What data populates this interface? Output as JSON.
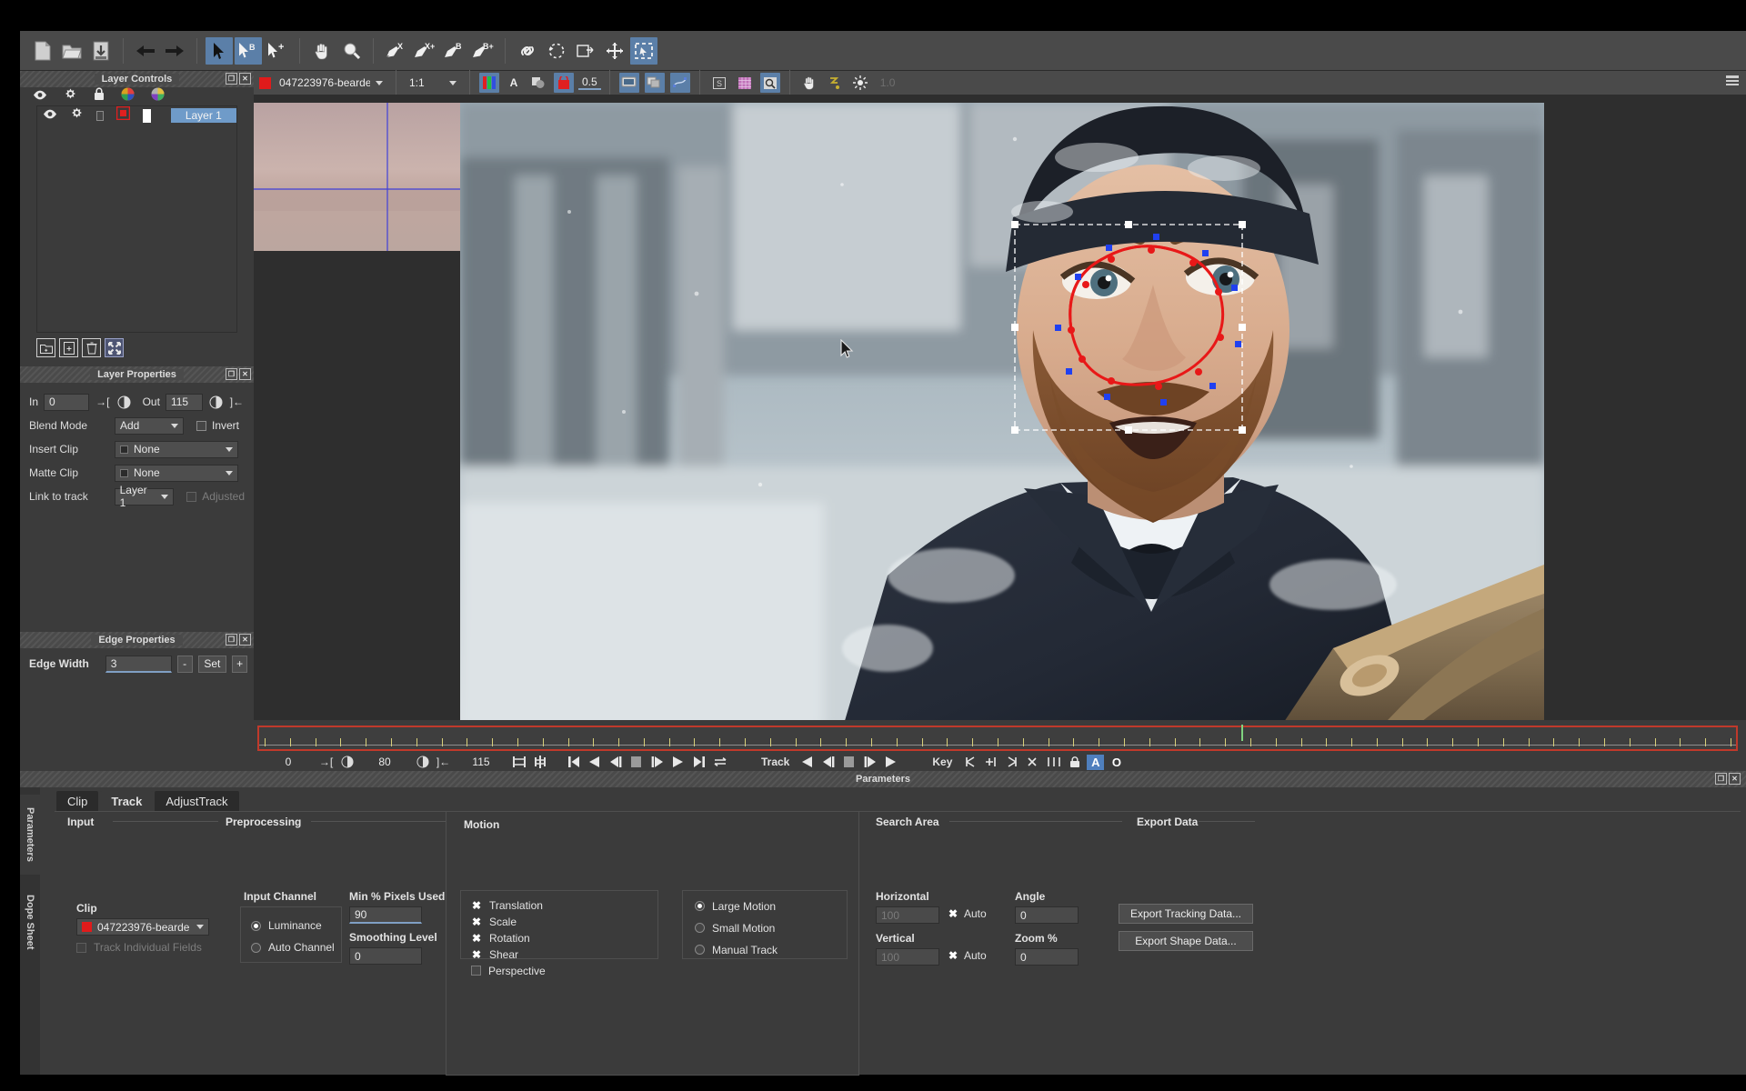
{
  "toolbar": {
    "groups": [
      {
        "name": "file",
        "buttons": [
          {
            "icon": "new-document-icon",
            "label": "New",
            "selected": false
          },
          {
            "icon": "open-folder-icon",
            "label": "Open",
            "selected": false
          },
          {
            "icon": "save-icon",
            "label": "Save",
            "selected": false
          }
        ]
      },
      {
        "name": "history",
        "buttons": [
          {
            "icon": "undo-arrow-icon",
            "label": "Undo",
            "selected": false
          },
          {
            "icon": "redo-arrow-icon",
            "label": "Redo",
            "selected": false
          }
        ]
      },
      {
        "name": "selection",
        "buttons": [
          {
            "icon": "pointer-icon",
            "label": "Select",
            "selected": true
          },
          {
            "icon": "pointer-b-icon",
            "label": "Select B-Spline",
            "selected": true
          },
          {
            "icon": "pointer-plus-icon",
            "label": "Add Point",
            "selected": false
          }
        ]
      },
      {
        "name": "navigation",
        "buttons": [
          {
            "icon": "hand-pan-icon",
            "label": "Pan",
            "selected": false
          },
          {
            "icon": "magnifier-icon",
            "label": "Zoom",
            "selected": false
          }
        ]
      },
      {
        "name": "pens",
        "buttons": [
          {
            "icon": "pen-x-icon",
            "label": "X-Spline",
            "selected": false
          },
          {
            "icon": "pen-x-plus-icon",
            "label": "X-Spline Add",
            "selected": false
          },
          {
            "icon": "pen-b-icon",
            "label": "B-Spline",
            "selected": false
          },
          {
            "icon": "pen-b-plus-icon",
            "label": "B-Spline Add",
            "selected": false
          }
        ]
      },
      {
        "name": "shape-tools",
        "buttons": [
          {
            "icon": "link-chain-icon",
            "label": "Link",
            "selected": false
          },
          {
            "icon": "lasso-icon",
            "label": "Lasso",
            "selected": false
          },
          {
            "icon": "duplicate-shape-icon",
            "label": "Duplicate",
            "selected": false
          },
          {
            "icon": "move-crosshair-icon",
            "label": "Move",
            "selected": false
          },
          {
            "icon": "marquee-select-icon",
            "label": "Marquee Select",
            "selected": true
          }
        ]
      }
    ]
  },
  "clipbar": {
    "clip_color": "#e01b1b",
    "clip_name": "047223976-bearde",
    "zoom_level": "1:1",
    "opacity": "0.5",
    "buttons": [
      {
        "icon": "rgb-channels-icon",
        "label": "RGB Channels",
        "selected": true
      },
      {
        "icon": "alpha-channel-icon",
        "label": "A",
        "selected": false
      },
      {
        "icon": "layers-overlay-icon",
        "label": "Overlay",
        "selected": false
      },
      {
        "icon": "matte-icon",
        "label": "Matte",
        "selected": true
      },
      {
        "icon": "monitor-icon",
        "label": "Monitor View",
        "selected": true
      },
      {
        "icon": "multi-view-icon",
        "label": "Multi View",
        "selected": true
      },
      {
        "icon": "points-view-icon",
        "label": "Point View",
        "selected": true
      },
      {
        "icon": "stabilize-icon",
        "label": "Stabilize",
        "selected": false
      },
      {
        "icon": "grid-icon",
        "label": "Grid",
        "selected": false
      },
      {
        "icon": "magnifier-box-icon",
        "label": "Magnifier",
        "selected": true
      },
      {
        "icon": "hand-small-icon",
        "label": "Hand",
        "selected": false
      },
      {
        "icon": "ruler-icon",
        "label": "Measure",
        "selected": false
      },
      {
        "icon": "brightness-icon",
        "label": "Brightness",
        "selected": false
      }
    ],
    "brightness_value": "1.0"
  },
  "layer_controls": {
    "title": "Layer Controls",
    "header_icons": [
      "eye-icon",
      "gear-icon",
      "lock-icon",
      "color-wheel-icon",
      "color-picker-icon"
    ],
    "rows": [
      {
        "name": "Layer 1",
        "visible": true,
        "settings": true,
        "locked": false,
        "color": "#e01b1b",
        "matte": "#ffffff"
      }
    ],
    "footer_buttons": [
      {
        "icon": "new-folder-icon",
        "label": "New Folder"
      },
      {
        "icon": "new-layer-icon",
        "label": "New Layer"
      },
      {
        "icon": "trash-icon",
        "label": "Delete"
      },
      {
        "icon": "expand-icon",
        "label": "Expand All"
      }
    ]
  },
  "layer_properties": {
    "title": "Layer Properties",
    "in_label": "In",
    "in_value": "0",
    "out_label": "Out",
    "out_value": "115",
    "blend_mode_label": "Blend Mode",
    "blend_mode_value": "Add",
    "invert_label": "Invert",
    "invert_checked": false,
    "insert_clip_label": "Insert Clip",
    "insert_clip_value": "None",
    "matte_clip_label": "Matte Clip",
    "matte_clip_value": "None",
    "link_to_track_label": "Link to track",
    "link_to_track_value": "Layer 1",
    "adjusted_label": "Adjusted",
    "adjusted_checked": false
  },
  "edge_properties": {
    "title": "Edge Properties",
    "edge_width_label": "Edge Width",
    "edge_width_value": "3",
    "minus_label": "-",
    "set_label": "Set",
    "plus_label": "+"
  },
  "timeline": {
    "start_frame": "0",
    "mid_frame": "80",
    "end_frame": "115",
    "current_frame": "115",
    "playhead_pct": 66.5,
    "track_label": "Track",
    "key_label": "Key",
    "transport_icons": [
      "go-to-start-icon",
      "play-backward-icon",
      "step-backward-icon",
      "stop-icon",
      "step-forward-icon",
      "play-forward-icon",
      "go-to-end-icon",
      "loop-icon"
    ],
    "track_icons": [
      "track-backward-icon",
      "track-step-backward-icon",
      "track-stop-icon",
      "track-step-forward-icon",
      "track-forward-icon"
    ],
    "key_icons": [
      "key-prev-icon",
      "key-add-icon",
      "key-next-icon",
      "key-delete-icon",
      "key-all-icon",
      "key-lock-icon"
    ],
    "toggle_a": "A",
    "toggle_o": "O"
  },
  "parameters": {
    "title": "Parameters",
    "vertical_tabs": [
      {
        "label": "Parameters",
        "active": true
      },
      {
        "label": "Dope Sheet",
        "active": false
      }
    ],
    "tabs": [
      {
        "label": "Clip",
        "active": false
      },
      {
        "label": "Track",
        "active": true
      },
      {
        "label": "AdjustTrack",
        "active": false
      }
    ],
    "input": {
      "group": "Input",
      "clip_label": "Clip",
      "clip_color": "#e01b1b",
      "clip_value": "047223976-bearde",
      "track_individual_fields_label": "Track Individual Fields",
      "track_individual_fields_checked": false
    },
    "preprocessing": {
      "group": "Preprocessing",
      "input_channel_label": "Input Channel",
      "channels": [
        {
          "label": "Luminance",
          "selected": true
        },
        {
          "label": "Auto Channel",
          "selected": false
        }
      ],
      "min_pixels_label": "Min % Pixels Used",
      "min_pixels_value": "90",
      "smoothing_label": "Smoothing Level",
      "smoothing_value": "0"
    },
    "motion": {
      "group": "Motion",
      "transforms": [
        {
          "label": "Translation",
          "checked": true
        },
        {
          "label": "Scale",
          "checked": true
        },
        {
          "label": "Rotation",
          "checked": true
        },
        {
          "label": "Shear",
          "checked": true
        },
        {
          "label": "Perspective",
          "checked": false
        }
      ],
      "modes": [
        {
          "label": "Large Motion",
          "selected": true
        },
        {
          "label": "Small Motion",
          "selected": false
        },
        {
          "label": "Manual Track",
          "selected": false
        }
      ]
    },
    "search_area": {
      "group": "Search Area",
      "horizontal_label": "Horizontal",
      "horizontal_value": "100",
      "horizontal_auto_label": "Auto",
      "horizontal_auto_checked": true,
      "vertical_label": "Vertical",
      "vertical_value": "100",
      "vertical_auto_label": "Auto",
      "vertical_auto_checked": true,
      "angle_label": "Angle",
      "angle_value": "0",
      "zoom_label": "Zoom %",
      "zoom_value": "0"
    },
    "export": {
      "group": "Export Data",
      "export_tracking_label": "Export Tracking Data...",
      "export_shape_label": "Export Shape Data..."
    }
  },
  "colors": {
    "panel_bg": "#3b3b3b",
    "toolbar_bg": "#4a4a4a",
    "accent_blue": "#5b7fa8",
    "selection_blue": "#6f9bc9",
    "timeline_red": "#c0392b",
    "spline_red": "#e02020",
    "clip_red": "#e01b1b"
  }
}
